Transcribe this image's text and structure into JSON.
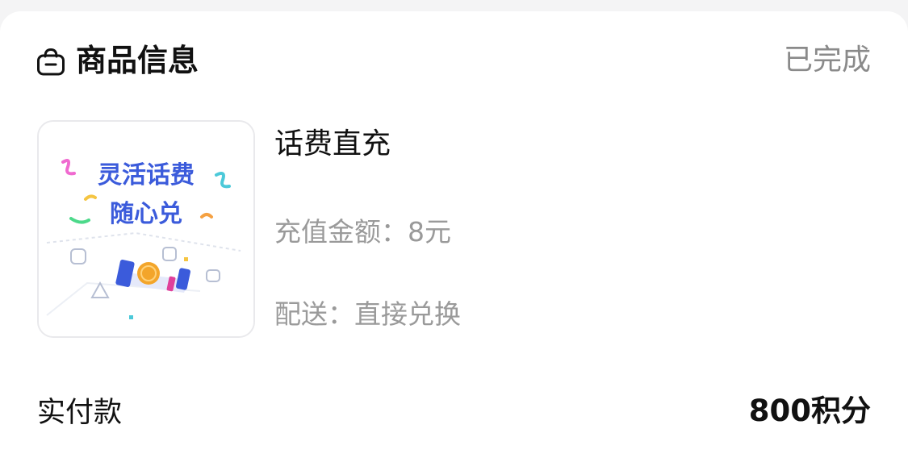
{
  "header": {
    "icon": "shopping-bag-icon",
    "title": "商品信息",
    "status": "已完成"
  },
  "product": {
    "name": "话费直充",
    "thumbnail": {
      "line1": "灵活话费",
      "line2": "随心兑"
    },
    "amount_label": "充值金额：",
    "amount_value": "8元",
    "delivery_label": "配送：",
    "delivery_value": "直接兑换"
  },
  "payment": {
    "label": "实付款",
    "value": "800积分"
  },
  "colors": {
    "background": "#f4f4f5",
    "card": "#ffffff",
    "primary_text": "#111111",
    "secondary_text": "#9a9a9a",
    "status_text": "#8a8a8a",
    "thumb_title": "#3b5bdb"
  }
}
